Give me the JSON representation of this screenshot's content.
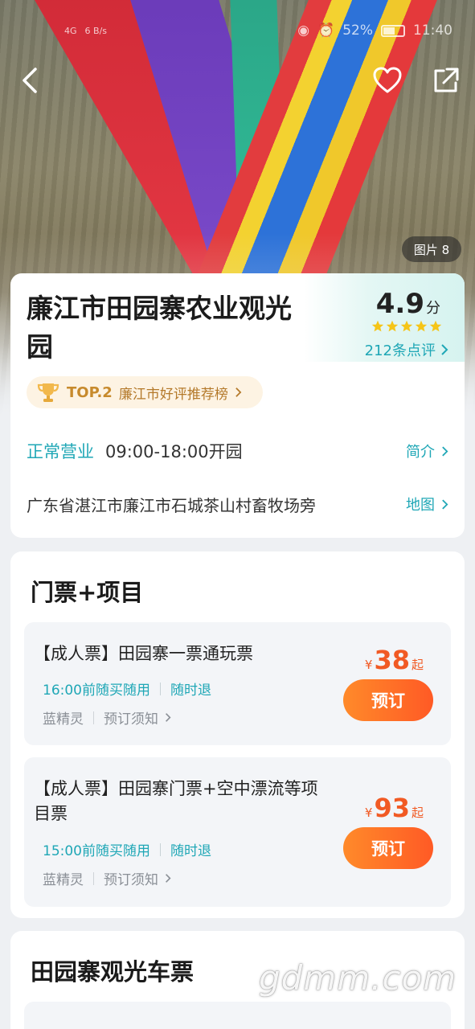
{
  "status_bar": {
    "signal_left": "4G",
    "network_speed": "6 B/s",
    "battery_percent": "52%",
    "time": "11:40"
  },
  "hero": {
    "photo_count": "图片 8"
  },
  "poi": {
    "title": "廉江市田园寨农业观光园",
    "rating": "4.9",
    "rating_unit": "分",
    "rating_stars": 5,
    "reviews": "212条点评",
    "rank_badge": "TOP.2",
    "rank_text": "廉江市好评推荐榜",
    "status": "正常营业",
    "hours": "09:00-18:00开园",
    "intro_link": "简介",
    "address": "广东省湛江市廉江市石城茶山村畜牧场旁",
    "map_link": "地图"
  },
  "tickets_section": {
    "title": "门票+项目",
    "items": [
      {
        "name": "【成人票】田园寨一票通玩票",
        "tag1": "16:00前随买随用",
        "tag2": "随时退",
        "supplier": "蓝精灵",
        "notice": "预订须知",
        "price_symbol": "¥",
        "price": "38",
        "price_suffix": "起",
        "book_label": "预订"
      },
      {
        "name": "【成人票】田园寨门票+空中漂流等项目票",
        "tag1": "15:00前随买随用",
        "tag2": "随时退",
        "supplier": "蓝精灵",
        "notice": "预订须知",
        "price_symbol": "¥",
        "price": "93",
        "price_suffix": "起",
        "book_label": "预订"
      }
    ]
  },
  "bus_section": {
    "title": "田园寨观光车票"
  },
  "watermark": "gdmm.com",
  "colors": {
    "accent": "#1fa7b6",
    "price": "#f15a24",
    "button_start": "#ff8a2a",
    "button_end": "#ff5a25",
    "star": "#f5c518"
  }
}
